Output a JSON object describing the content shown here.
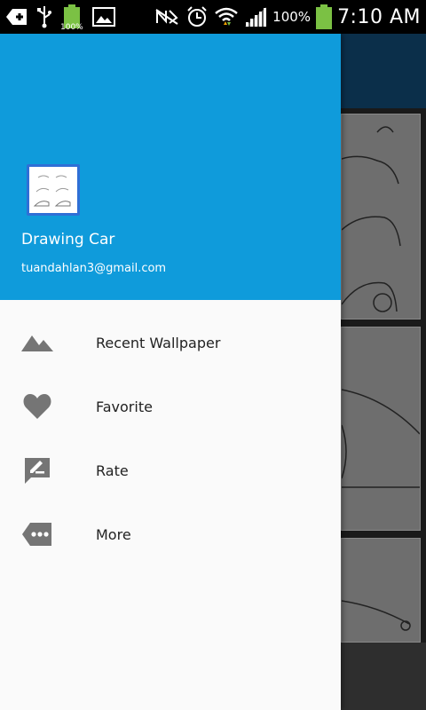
{
  "status_bar": {
    "battery_small_label": "100%",
    "battery_percent": "100%",
    "time": "7:10 AM"
  },
  "drawer": {
    "app_name": "Drawing Car",
    "email": "tuandahlan3@gmail.com",
    "items": [
      {
        "label": "Recent Wallpaper",
        "icon": "landscape-icon"
      },
      {
        "label": "Favorite",
        "icon": "heart-icon"
      },
      {
        "label": "Rate",
        "icon": "rate-review-icon"
      },
      {
        "label": "More",
        "icon": "more-tag-icon"
      }
    ]
  },
  "colors": {
    "header": "#0f9bdb",
    "toolbar_behind": "#0b2f4a",
    "icon_gray": "#757575"
  }
}
